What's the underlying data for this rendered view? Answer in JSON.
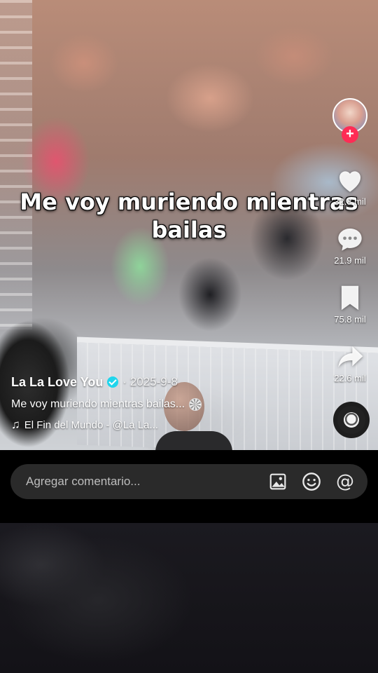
{
  "video": {
    "overlay_caption": "Me voy muriendo mientras bailas"
  },
  "actions": {
    "likes": "32.8 mil",
    "comments": "21.9 mil",
    "saves": "75.8 mil",
    "shares": "22.6 mil"
  },
  "info": {
    "author": "La La Love You",
    "date": "· 2025-9-8",
    "description": "Me voy muriendo mientras bailas...",
    "music": "El Fin del Mundo - @La La..."
  },
  "comment": {
    "placeholder": "Agregar comentario..."
  },
  "icons": {
    "follow": "plus-icon",
    "like": "heart-icon",
    "comment": "comment-bubble-icon",
    "save": "bookmark-icon",
    "share": "share-arrow-icon",
    "verified": "verified-badge-icon",
    "music": "music-note-icon",
    "image": "image-icon",
    "emoji": "emoji-icon",
    "mention": "at-icon"
  },
  "colors": {
    "follow_button": "#fe2c55",
    "verified_badge": "#20d5ec",
    "comment_box": "#2a2a2a"
  }
}
